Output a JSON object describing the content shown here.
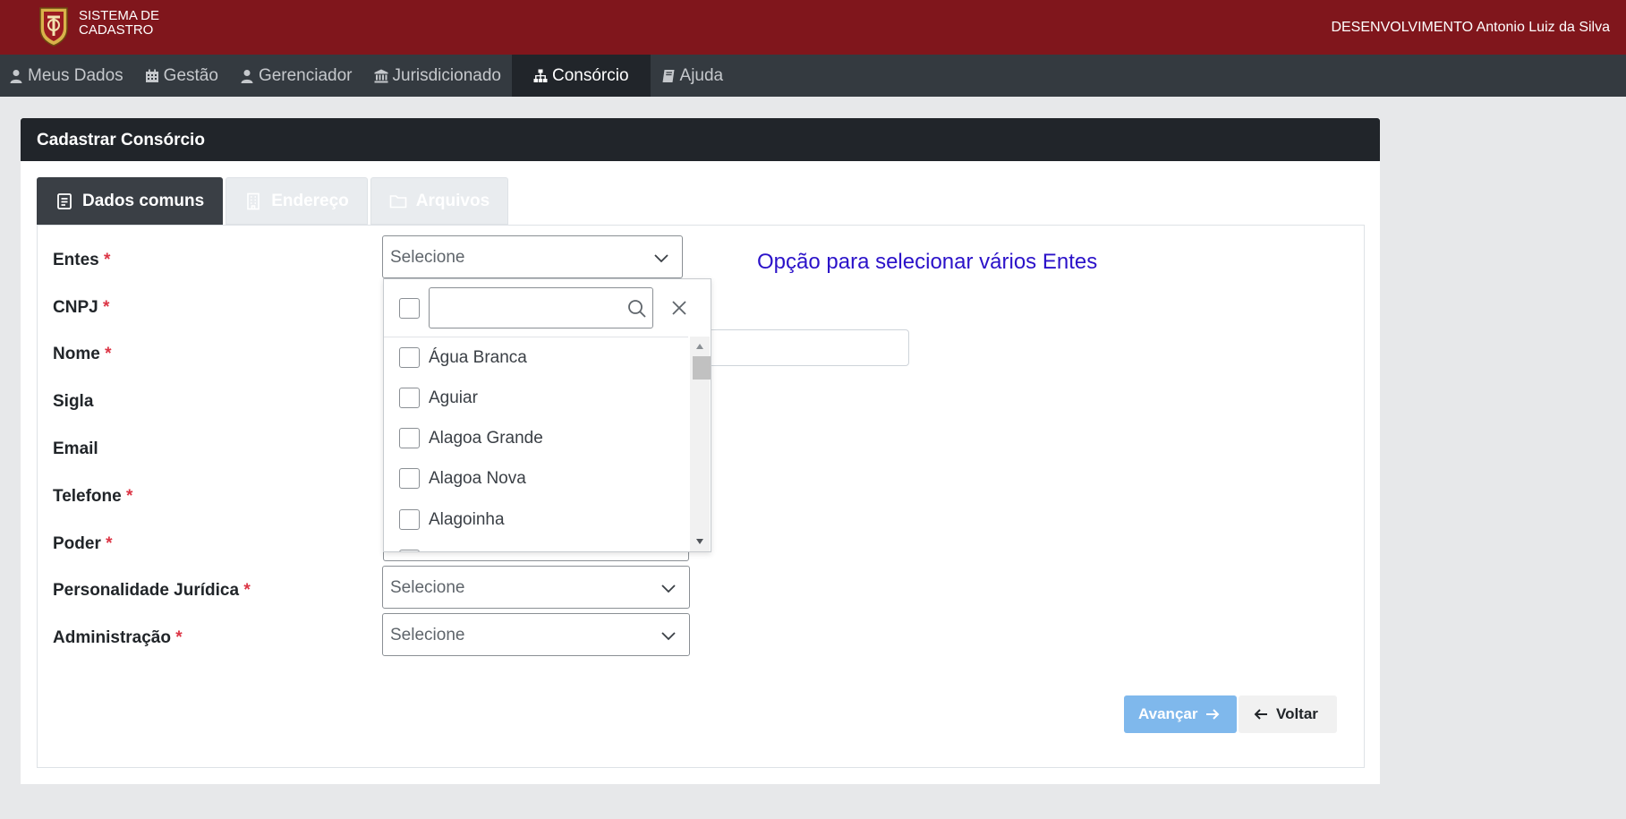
{
  "header": {
    "brand_line1": "SISTEMA DE",
    "brand_line2": "CADASTRO",
    "user": "DESENVOLVIMENTO Antonio Luiz da Silva"
  },
  "nav": {
    "items": [
      {
        "label": "Meus Dados",
        "icon": "user-icon"
      },
      {
        "label": "Gestão",
        "icon": "calendar-icon"
      },
      {
        "label": "Gerenciador",
        "icon": "user-icon"
      },
      {
        "label": "Jurisdicionado",
        "icon": "bank-icon"
      },
      {
        "label": "Consórcio",
        "icon": "sitemap-icon",
        "active": true
      },
      {
        "label": "Ajuda",
        "icon": "book-icon"
      }
    ]
  },
  "card": {
    "title": "Cadastrar Consórcio"
  },
  "tabs": [
    {
      "label": "Dados comuns",
      "icon": "document-icon",
      "active": true
    },
    {
      "label": "Endereço",
      "icon": "building-icon"
    },
    {
      "label": "Arquivos",
      "icon": "folder-icon"
    }
  ],
  "form": {
    "required_mark": "*",
    "fields": [
      {
        "label": "Entes",
        "required": true
      },
      {
        "label": "CNPJ",
        "required": true
      },
      {
        "label": "Nome",
        "required": true
      },
      {
        "label": "Sigla",
        "required": false
      },
      {
        "label": "Email",
        "required": false
      },
      {
        "label": "Telefone",
        "required": true
      },
      {
        "label": "Poder",
        "required": true
      },
      {
        "label": "Personalidade Jurídica",
        "required": true
      },
      {
        "label": "Administração",
        "required": true
      }
    ],
    "select_placeholder": "Selecione",
    "hint": "Opção para selecionar vários Entes"
  },
  "dropdown": {
    "search_value": "",
    "options": [
      "Água Branca",
      "Aguiar",
      "Alagoa Grande",
      "Alagoa Nova",
      "Alagoinha"
    ]
  },
  "buttons": {
    "next": "Avançar",
    "back": "Voltar"
  },
  "colors": {
    "header_bg": "#80161c",
    "nav_bg": "#343a40",
    "accent_next": "#7fb8ec",
    "hint": "#2b12c9",
    "required": "#dc3545"
  }
}
